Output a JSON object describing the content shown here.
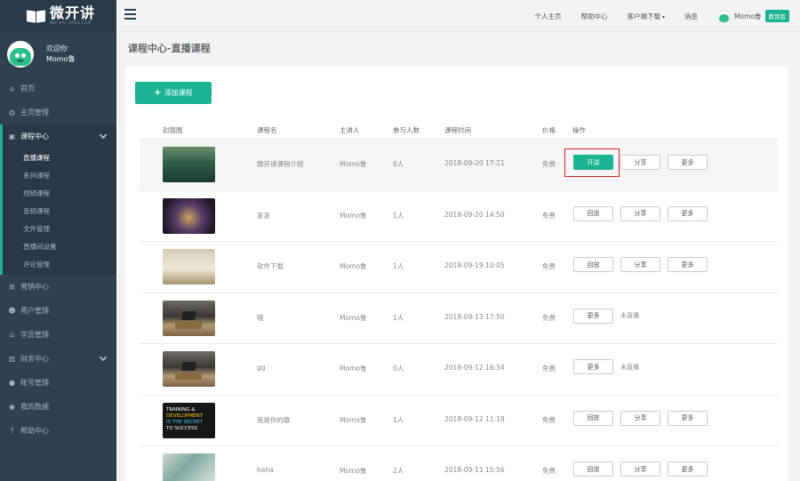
{
  "brand": {
    "name": "微开讲",
    "subtitle": "WEI KAI JIANG.COM"
  },
  "profile": {
    "greeting": "欢迎你",
    "name": "Momo鲁"
  },
  "nav": {
    "items": [
      {
        "label": "首页",
        "icon": "home-icon"
      },
      {
        "label": "主页管理",
        "icon": "globe-icon"
      },
      {
        "label": "课程中心",
        "icon": "briefcase-icon"
      }
    ],
    "sub": [
      "直播课程",
      "系列课程",
      "视频课程",
      "音频课程",
      "文件管理",
      "直播间设置",
      "评论管理"
    ],
    "bottom": [
      {
        "label": "营销中心",
        "icon": "sitemap-icon"
      },
      {
        "label": "用户管理",
        "icon": "users-icon"
      },
      {
        "label": "学员管理",
        "icon": "graduation-cap-icon"
      },
      {
        "label": "财务中心",
        "icon": "bar-chart-icon"
      },
      {
        "label": "账号管理",
        "icon": "user-icon"
      },
      {
        "label": "我的数据",
        "icon": "database-icon"
      },
      {
        "label": "帮助中心",
        "icon": "question-icon"
      }
    ]
  },
  "topbar": {
    "links": [
      "个人主页",
      "帮助中心",
      "客户端下载",
      "消息"
    ],
    "user": "Momo鲁",
    "badge": "教育版"
  },
  "page": {
    "title": "课程中心-直播课程",
    "add_button": "添加课程"
  },
  "table": {
    "headers": [
      "封面图",
      "课程名",
      "主讲人",
      "参与人数",
      "课程时间",
      "价格",
      "操作"
    ],
    "rows": [
      {
        "name": "微开讲课程介绍",
        "speaker": "Momo鲁",
        "count": "0人",
        "time": "2018-09-20 17:21",
        "price": "免费",
        "ops": [
          "开讲",
          "分享",
          "更多"
        ]
      },
      {
        "name": "发发",
        "speaker": "Momo鲁",
        "count": "1人",
        "time": "2018-09-20 14:50",
        "price": "免费",
        "ops": [
          "回放",
          "分享",
          "更多"
        ]
      },
      {
        "name": "软件下载",
        "speaker": "Momo鲁",
        "count": "1人",
        "time": "2018-09-19 10:05",
        "price": "免费",
        "ops": [
          "回放",
          "分享",
          "更多"
        ]
      },
      {
        "name": "哦",
        "speaker": "Momo鲁",
        "count": "1人",
        "time": "2018-09-13 17:50",
        "price": "免费",
        "ops": [
          "更多",
          "未直播"
        ]
      },
      {
        "name": "gg",
        "speaker": "Momo鲁",
        "count": "0人",
        "time": "2018-09-12 16:34",
        "price": "免费",
        "ops": [
          "更多",
          "未直播"
        ]
      },
      {
        "name": "我是你的歌",
        "speaker": "Momo鲁",
        "count": "1人",
        "time": "2018-09-12 11:18",
        "price": "免费",
        "ops": [
          "回放",
          "分享",
          "更多"
        ]
      },
      {
        "name": "haha",
        "speaker": "Momo鲁",
        "count": "2人",
        "time": "2018-09-11 15:56",
        "price": "免费",
        "ops": [
          "回放",
          "分享",
          "更多"
        ]
      }
    ],
    "thumb6_text": [
      "TRAINING &",
      "DEVELOPMENT",
      "IS THE SECRET",
      "TO SUCCESS"
    ]
  },
  "colors": {
    "accent": "#1ab394",
    "sidebar": "#2f4050",
    "highlight": "#e02020"
  }
}
